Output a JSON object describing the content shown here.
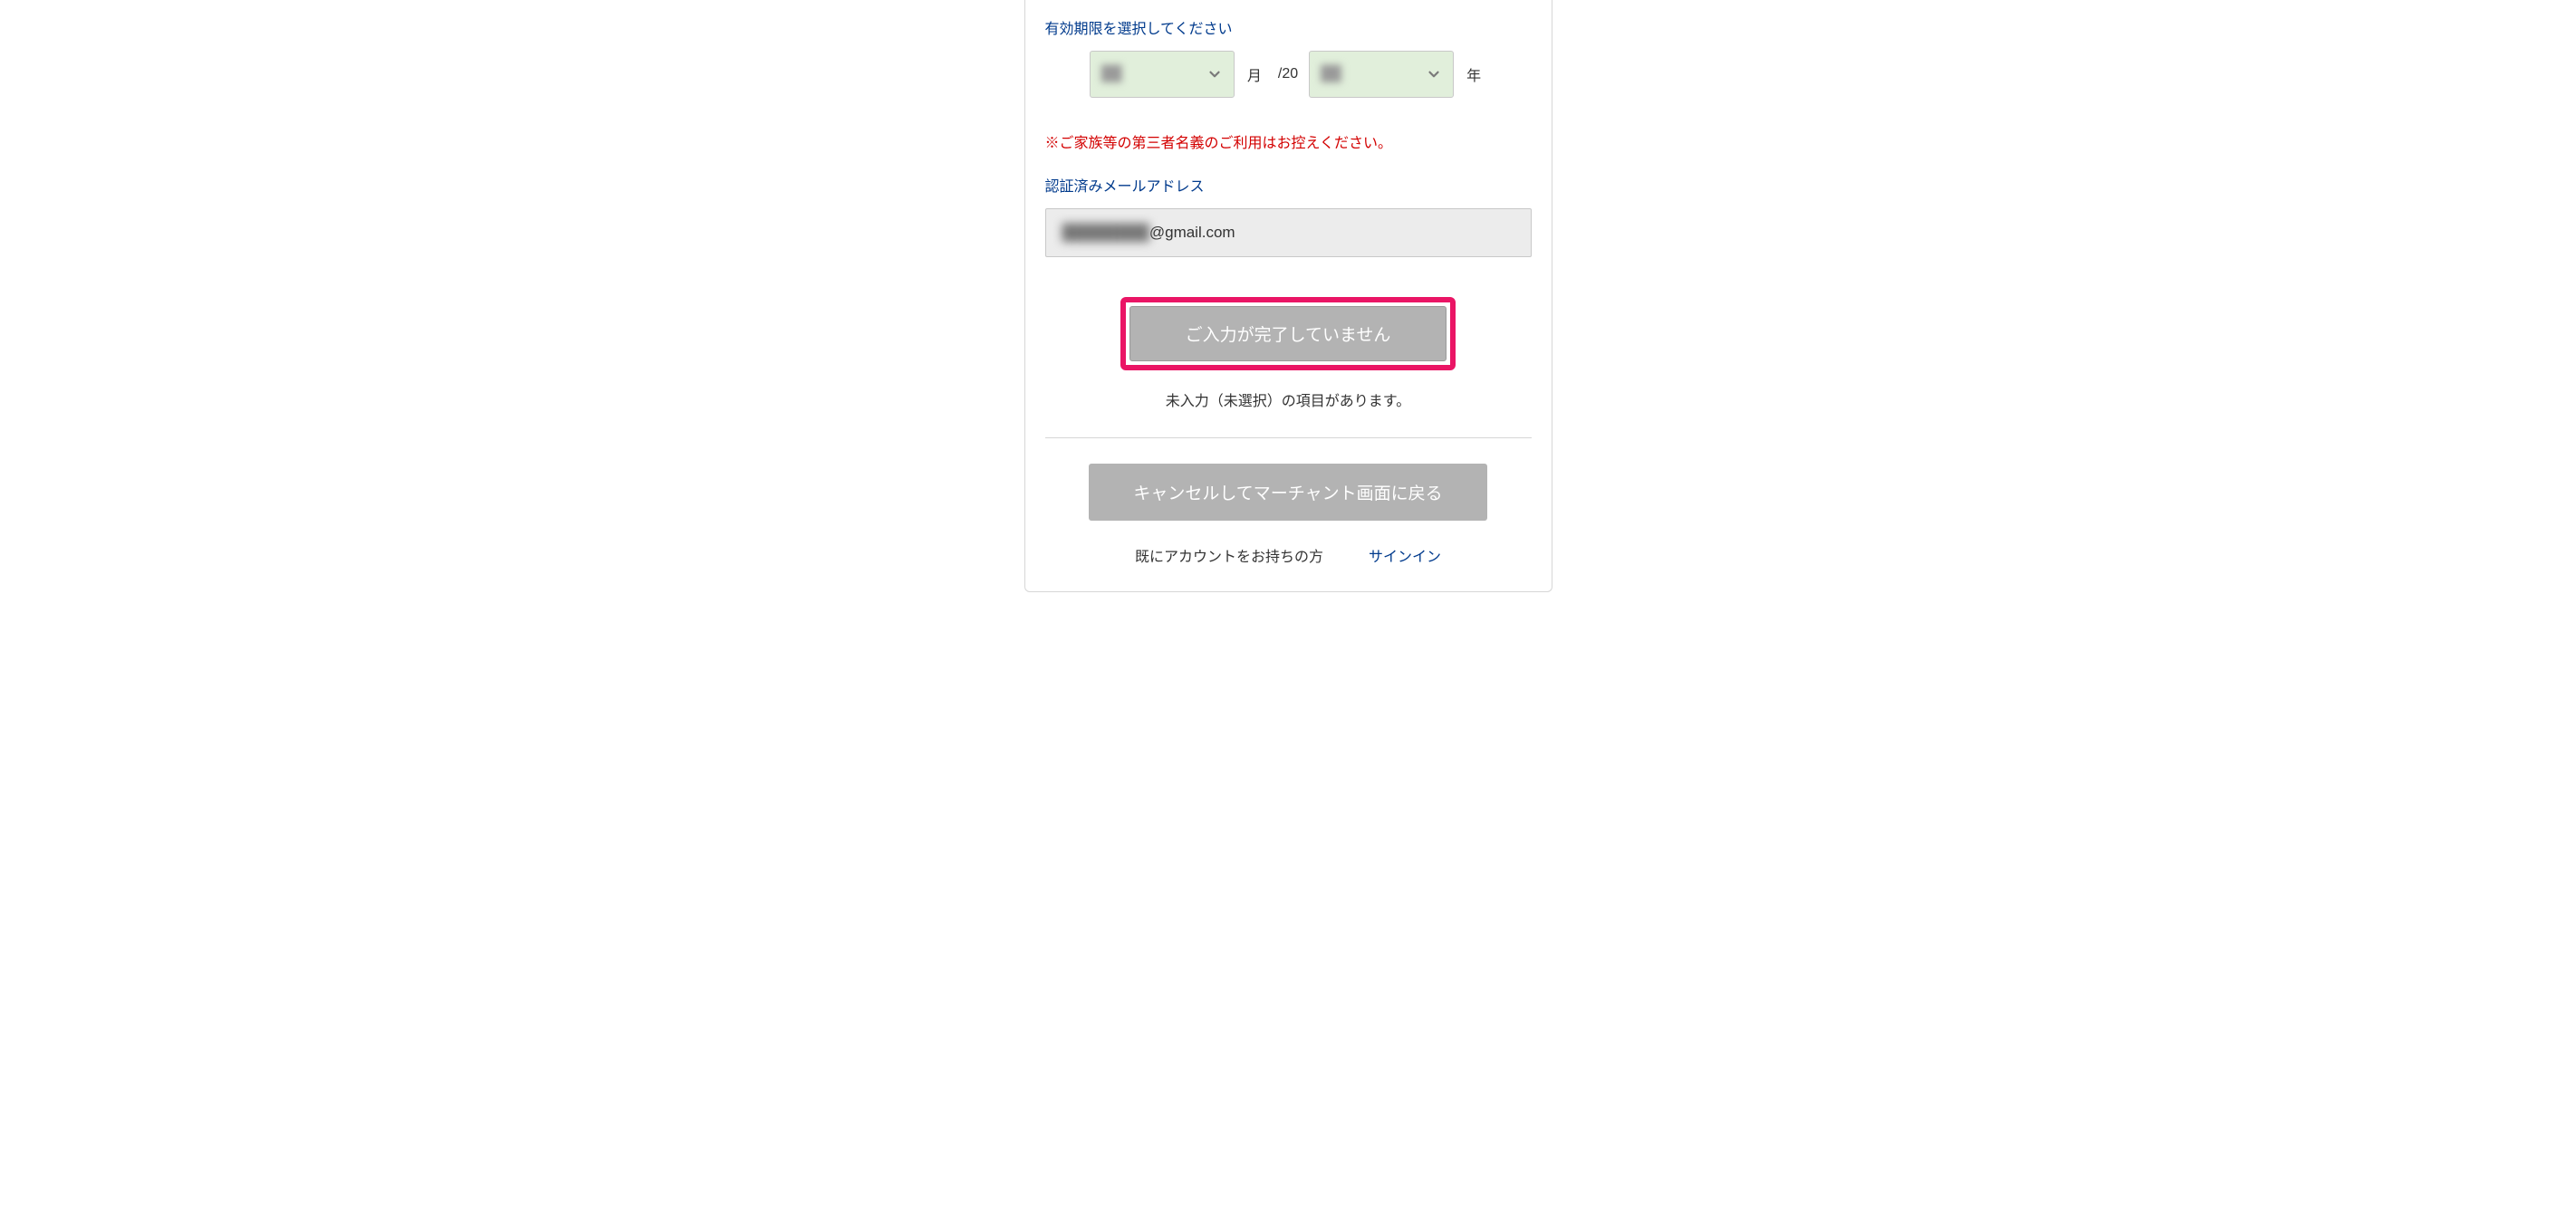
{
  "expiry": {
    "label": "有効期限を選択してください",
    "month_value": "██",
    "month_unit": "月",
    "year_prefix": "/20",
    "year_value": "██",
    "year_unit": "年"
  },
  "warning": "※ご家族等の第三者名義のご利用はお控えください。",
  "email": {
    "label": "認証済みメールアドレス",
    "masked_local": "████████",
    "domain": "@gmail.com"
  },
  "submit": {
    "button_label": "ご入力が完了していません",
    "sub_message": "未入力（未選択）の項目があります。"
  },
  "cancel": {
    "button_label": "キャンセルしてマーチャント画面に戻る"
  },
  "signin": {
    "prompt": "既にアカウントをお持ちの方",
    "link_label": "サインイン"
  }
}
